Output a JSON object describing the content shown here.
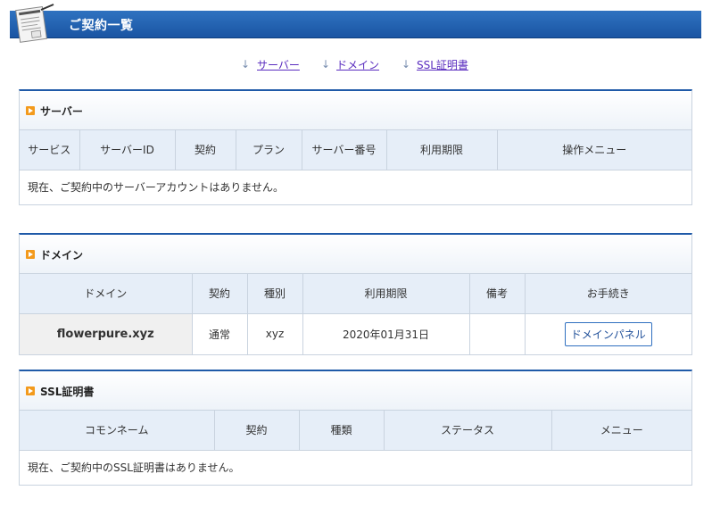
{
  "header": {
    "title": "ご契約一覧"
  },
  "anchors": [
    {
      "label": "サーバー"
    },
    {
      "label": "ドメイン"
    },
    {
      "label": "SSL証明書"
    }
  ],
  "server_section": {
    "title": "サーバー",
    "columns": [
      "サービス",
      "サーバーID",
      "契約",
      "プラン",
      "サーバー番号",
      "利用期限",
      "操作メニュー"
    ],
    "empty_message": "現在、ご契約中のサーバーアカウントはありません。"
  },
  "domain_section": {
    "title": "ドメイン",
    "columns": [
      "ドメイン",
      "契約",
      "種別",
      "利用期限",
      "備考",
      "お手続き"
    ],
    "rows": [
      {
        "domain": "flowerpure.xyz",
        "contract": "通常",
        "type": "xyz",
        "expiry": "2020年01月31日",
        "note": "",
        "action": "ドメインパネル"
      }
    ]
  },
  "ssl_section": {
    "title": "SSL証明書",
    "columns": [
      "コモンネーム",
      "契約",
      "種類",
      "ステータス",
      "メニュー"
    ],
    "empty_message": "現在、ご契約中のSSL証明書はありません。"
  },
  "colors": {
    "header_bar": "#1a55a3",
    "section_top_border": "#1f5aa8",
    "marker": "#f39a1c",
    "link": "#5a2dbf"
  }
}
